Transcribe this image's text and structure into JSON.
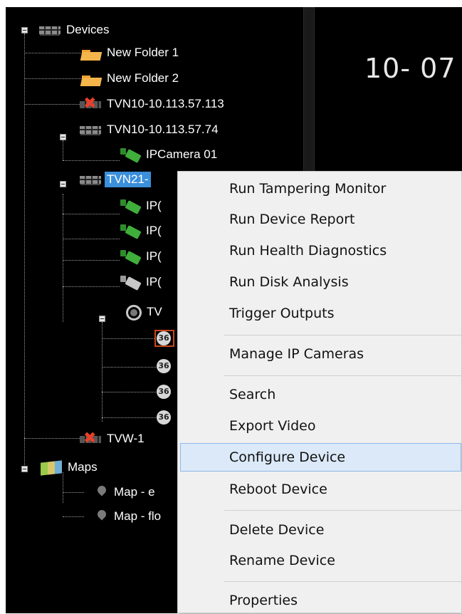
{
  "tree": {
    "root_label": "Devices",
    "nodes": [
      {
        "label": "New Folder 1",
        "icon": "folder-icon"
      },
      {
        "label": "New Folder 2",
        "icon": "folder-icon"
      },
      {
        "label": "TVN10-10.113.57.113",
        "icon": "device-error-icon"
      },
      {
        "label": "TVN10-10.113.57.74",
        "icon": "recorder-icon"
      },
      {
        "label": "IPCamera 01",
        "icon": "camera-icon"
      },
      {
        "label": "TVN21-",
        "icon": "recorder-icon",
        "selected": true
      },
      {
        "label": "IP(",
        "icon": "camera-icon"
      },
      {
        "label": "IP(",
        "icon": "camera-icon"
      },
      {
        "label": "IP(",
        "icon": "camera-icon"
      },
      {
        "label": "IP(",
        "icon": "camera-offline-icon"
      },
      {
        "label": "TV",
        "icon": "dome-camera-icon"
      },
      {
        "label": "TVW-1",
        "icon": "device-error-icon"
      },
      {
        "label": "Maps",
        "icon": "map-icon"
      },
      {
        "label": "Map - e",
        "icon": "map-pin-icon"
      },
      {
        "label": "Map - flo",
        "icon": "map-pin-icon"
      }
    ],
    "fisheye_count": 4
  },
  "view": {
    "text": "10- 07"
  },
  "context_menu": {
    "items": [
      "Run Tampering Monitor",
      "Run Device Report",
      "Run Health Diagnostics",
      "Run Disk Analysis",
      "Trigger Outputs",
      "Manage IP Cameras",
      "Search",
      "Export Video",
      "Configure Device",
      "Reboot Device",
      "Delete Device",
      "Rename Device",
      "Properties"
    ],
    "highlighted": "Configure Device"
  },
  "colors": {
    "tree_bg": "#000000",
    "selection": "#3b8fdb",
    "menu_bg": "#f0f0f0",
    "menu_highlight": "#dbe9f8"
  }
}
